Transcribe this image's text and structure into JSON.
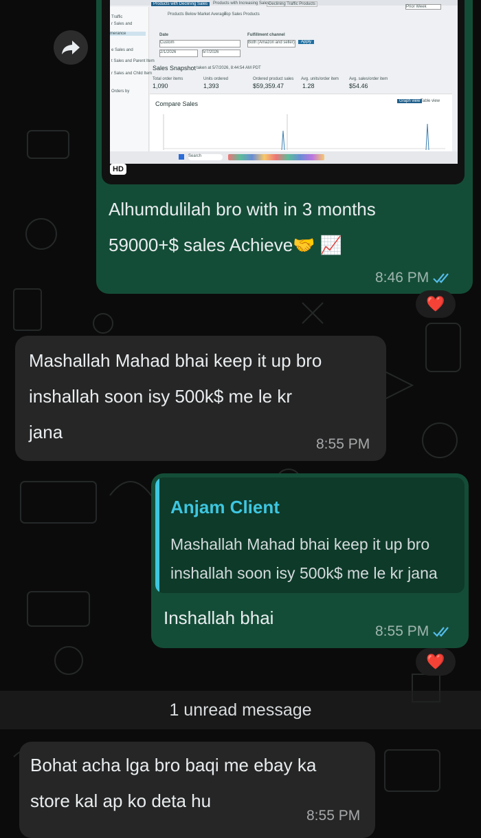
{
  "image": {
    "menu": [
      "Products with Declining Sales",
      "Products with Increasing Sales",
      "Declining Traffic Products"
    ],
    "menu2": [
      "Products Below Market Average",
      "Top Sales Products"
    ],
    "sidebar": [
      "Traffic",
      "r Sales and",
      "merance",
      "e Sales and",
      "t Sales and Parent Item",
      "r Sales and Child Item",
      "Orders by"
    ],
    "date_label": "Date",
    "date_value": "Custom",
    "date_from": "2/1/2026",
    "date_to": "5/7/2026",
    "fulfillment_label": "Fulfillment channel",
    "fulfillment_value": "Both (Amazon and seller)",
    "apply": "Apply",
    "snapshot_title": "Sales Snapshot",
    "snapshot_taken": "taken at 5/7/2026, 8:44:54 AM PDT",
    "metrics": [
      {
        "label": "Total order items",
        "value": "1,090"
      },
      {
        "label": "Units ordered",
        "value": "1,393"
      },
      {
        "label": "Ordered product sales",
        "value": "$59,359.47"
      },
      {
        "label": "Avg. units/order item",
        "value": "1.28"
      },
      {
        "label": "Avg. sales/order item",
        "value": "$54.46"
      }
    ],
    "compare_title": "Compare Sales",
    "graph_view": "Graph view",
    "table_view": "Table view",
    "prior_week": "Prior Week",
    "search": "Search",
    "hd_badge": "HD"
  },
  "messages": [
    {
      "text_line1": "Alhumdulilah bro with in 3 months",
      "text_line2": "59000+$ sales Achieve🤝 📈",
      "time": "8:46 PM",
      "reaction": "❤️"
    },
    {
      "text_line1": "Mashallah Mahad bhai keep it up bro",
      "text_line2": "inshallah soon isy 500k$ me le kr",
      "text_line3": "jana",
      "time": "8:55 PM"
    },
    {
      "quote_author": "Anjam Client",
      "quote_line1": "Mashallah Mahad bhai keep it up bro",
      "quote_line2": "inshallah soon isy 500k$ me le kr jana",
      "text": "Inshallah bhai",
      "time": "8:55 PM",
      "reaction": "❤️"
    },
    {
      "text_line1": "Bohat acha lga bro baqi me ebay ka",
      "text_line2": "store kal ap ko deta hu",
      "time": "8:55 PM"
    }
  ],
  "unread_divider": "1 unread message",
  "colors": {
    "outgoing": "#144d37",
    "incoming": "#262626",
    "quote_accent": "#3ec6e0",
    "read_ticks": "#53bdeb"
  },
  "icons": [
    "forward-icon",
    "double-check-icon",
    "heart-icon"
  ]
}
